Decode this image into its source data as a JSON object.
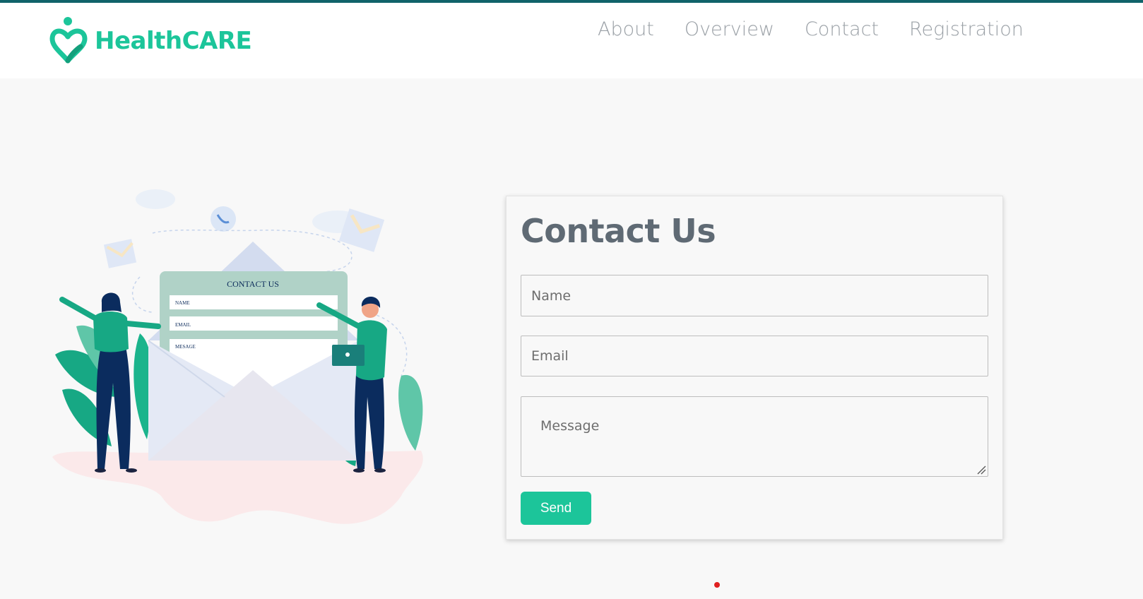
{
  "header": {
    "logo_text": "HealthCARE",
    "nav": [
      "About",
      "Overview",
      "Contact",
      "Registration"
    ]
  },
  "illustration": {
    "form_title": "CONTACT US",
    "fields": [
      "NAME",
      "EMAIL",
      "MESAGE"
    ]
  },
  "contact": {
    "title": "Contact Us",
    "name_placeholder": "Name",
    "email_placeholder": "Email",
    "message_placeholder": "Message",
    "send_label": "Send"
  },
  "colors": {
    "brand": "#1cc59a",
    "top_bar": "#10636a",
    "nav_text": "#9aa0a6",
    "title_text": "#5f6a74",
    "indicator_dot": "#e02020"
  },
  "icons": [
    "heart-logo-icon",
    "resize-handle-icon"
  ]
}
